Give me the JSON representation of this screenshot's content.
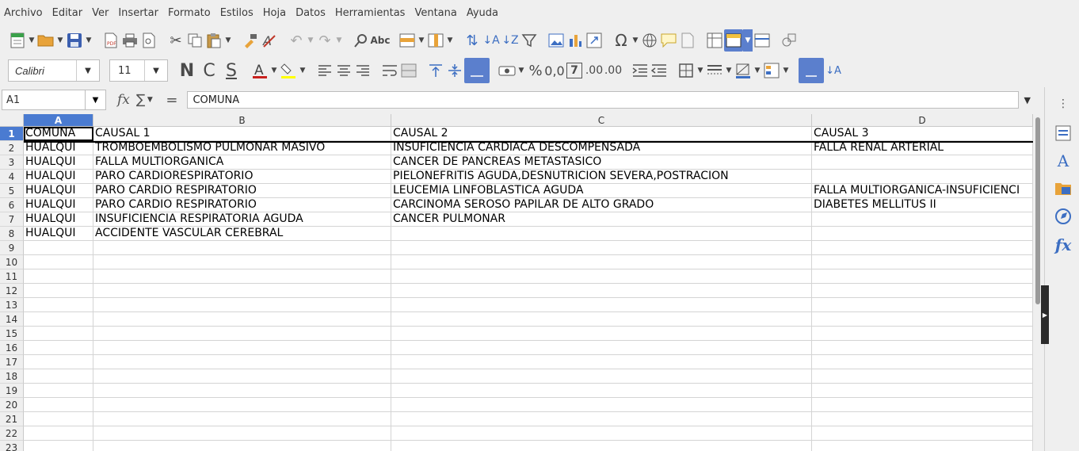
{
  "menu": [
    "Archivo",
    "Editar",
    "Ver",
    "Insertar",
    "Formato",
    "Estilos",
    "Hoja",
    "Datos",
    "Herramientas",
    "Ventana",
    "Ayuda"
  ],
  "toolbar": {
    "font_name": "Calibri",
    "font_size": "11",
    "bold_label": "N",
    "italic_label": "C",
    "underline_label": "S",
    "percent_label": "%",
    "decimal_label": "0,0",
    "seven_label": "7",
    "add_decimal_label": ".00",
    "remove_decimal_label": ".00"
  },
  "formula_bar": {
    "cell_ref": "A1",
    "fx": "fx",
    "sigma": "∑",
    "equals": "=",
    "content": "COMUNA"
  },
  "columns": [
    "A",
    "B",
    "C",
    "D"
  ],
  "rows": [
    "1",
    "2",
    "3",
    "4",
    "5",
    "6",
    "7",
    "8",
    "9",
    "10",
    "11",
    "12",
    "13",
    "14",
    "15",
    "16",
    "17",
    "18",
    "19",
    "20",
    "21",
    "22",
    "23"
  ],
  "cells": [
    [
      "COMUNA",
      "CAUSAL 1",
      "CAUSAL 2",
      "CAUSAL 3"
    ],
    [
      "HUALQUI",
      "TROMBOEMBOLISMO PULMONAR MASIVO",
      "INSUFICIENCIA CARDIACA DESCOMPENSADA",
      "FALLA RENAL ARTERIAL"
    ],
    [
      "HUALQUI",
      "FALLA MULTIORGANICA",
      "CANCER DE PANCREAS METASTASICO",
      ""
    ],
    [
      "HUALQUI",
      "PARO CARDIORESPIRATORIO",
      "PIELONEFRITIS AGUDA,DESNUTRICION SEVERA,POSTRACION",
      ""
    ],
    [
      "HUALQUI",
      "PARO CARDIO RESPIRATORIO",
      "LEUCEMIA LINFOBLASTICA AGUDA",
      "FALLA MULTIORGANICA-INSUFICIENCI"
    ],
    [
      "HUALQUI",
      "PARO CARDIO RESPIRATORIO",
      "CARCINOMA SEROSO PAPILAR DE ALTO GRADO",
      "DIABETES MELLITUS II"
    ],
    [
      "HUALQUI",
      "INSUFICIENCIA RESPIRATORIA AGUDA",
      "CANCER PULMONAR",
      ""
    ],
    [
      "HUALQUI",
      "ACCIDENTE VASCULAR CEREBRAL",
      "",
      ""
    ]
  ]
}
